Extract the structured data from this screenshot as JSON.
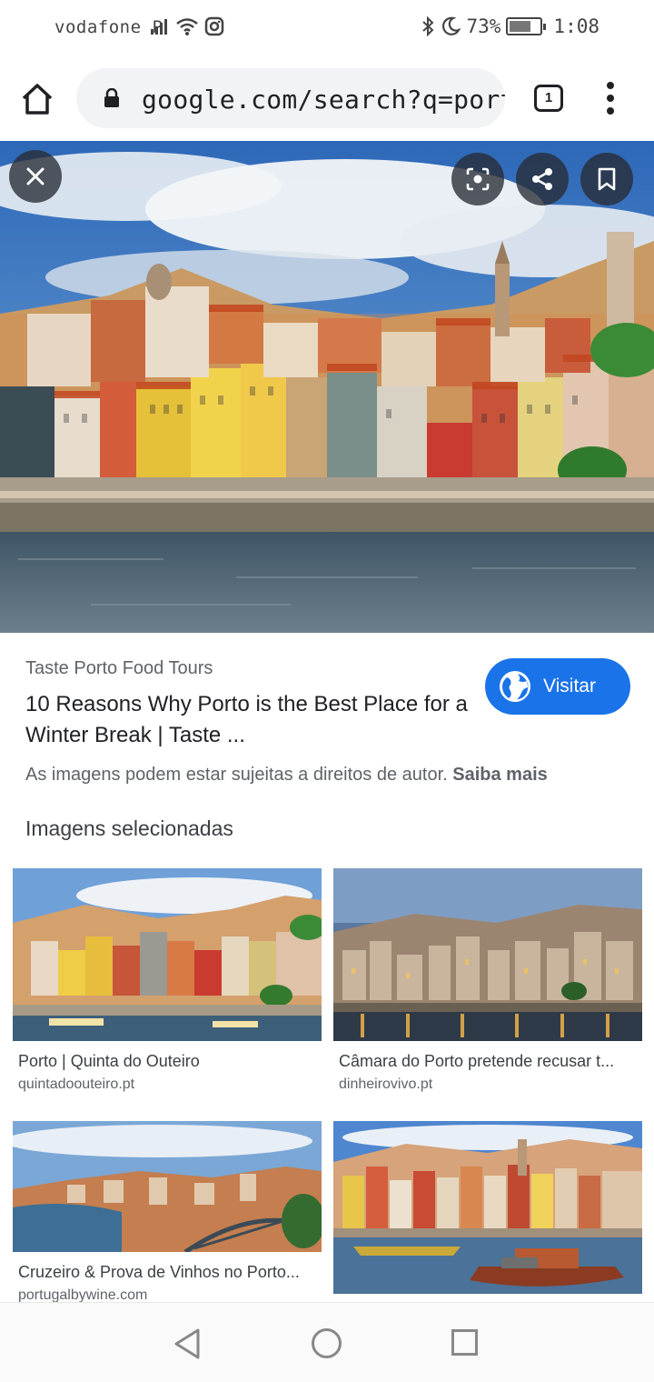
{
  "status_bar": {
    "carrier": "vodafone P",
    "battery_percent": "73%",
    "time": "1:08",
    "battery_level": 0.73
  },
  "browser": {
    "url": "google.com/search?q=porto",
    "tabs_count": "1"
  },
  "result": {
    "source": "Taste Porto Food Tours",
    "title": "10 Reasons Why Porto is the Best Place for a Winter Break | Taste ...",
    "visit_label": "Visitar",
    "copyright_text": "As imagens podem estar sujeitas a direitos de autor.",
    "learn_more": "Saiba mais"
  },
  "related": {
    "heading": "Imagens selecionadas",
    "items": [
      {
        "caption": "Porto | Quinta do Outeiro",
        "domain": "quintadoouteiro.pt"
      },
      {
        "caption": "Câmara do Porto pretende recusar t...",
        "domain": "dinheirovivo.pt"
      },
      {
        "caption": "Cruzeiro & Prova de Vinhos no Porto...",
        "domain": "portugalbywine.com"
      },
      {
        "caption": "",
        "domain": ""
      }
    ]
  },
  "colors": {
    "accent": "#1a73e8",
    "omnibox": "#f1f3f4"
  }
}
